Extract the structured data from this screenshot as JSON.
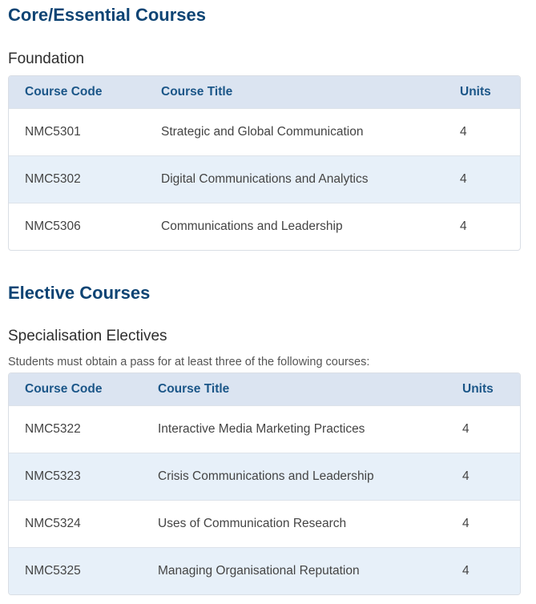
{
  "core": {
    "heading": "Core/Essential Courses",
    "subheading": "Foundation",
    "columns": {
      "code": "Course Code",
      "title": "Course Title",
      "units": "Units"
    },
    "rows": [
      {
        "code": "NMC5301",
        "title": "Strategic and Global Communication",
        "units": "4"
      },
      {
        "code": "NMC5302",
        "title": "Digital Communications and Analytics",
        "units": "4"
      },
      {
        "code": "NMC5306",
        "title": "Communications and Leadership",
        "units": "4"
      }
    ]
  },
  "elective": {
    "heading": "Elective Courses",
    "subheading": "Specialisation Electives",
    "note": "Students must obtain a pass for at least three of the following courses:",
    "columns": {
      "code": "Course Code",
      "title": "Course Title",
      "units": "Units"
    },
    "rows": [
      {
        "code": "NMC5322",
        "title": "Interactive Media Marketing Practices",
        "units": "4"
      },
      {
        "code": "NMC5323",
        "title": "Crisis Communications and Leadership",
        "units": "4"
      },
      {
        "code": "NMC5324",
        "title": "Uses of Communication Research",
        "units": "4"
      },
      {
        "code": "NMC5325",
        "title": "Managing Organisational Reputation",
        "units": "4"
      }
    ]
  }
}
